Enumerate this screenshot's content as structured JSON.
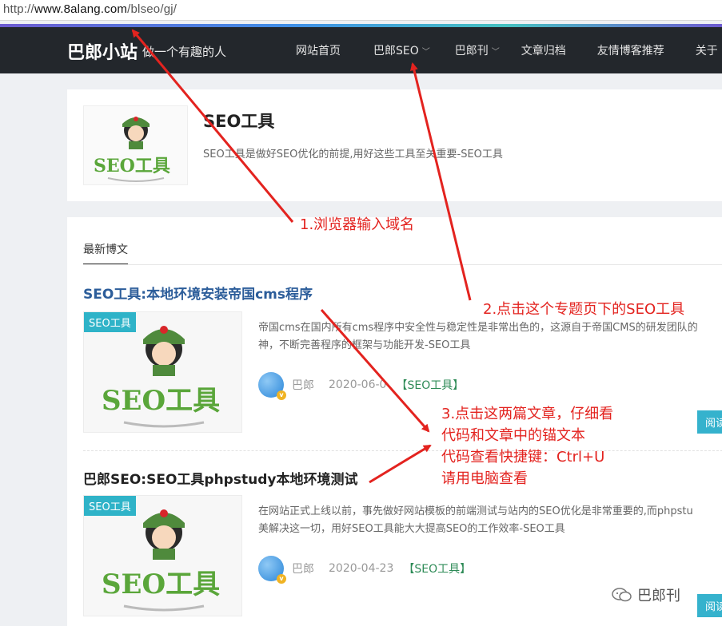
{
  "browser": {
    "url_prefix": "http://",
    "url_domain": "www.8alang.com",
    "url_path": "/blseo/gj/"
  },
  "header": {
    "brand": "巴郎小站",
    "slogan": "做一个有趣的人",
    "nav": [
      {
        "label": "网站首页",
        "dropdown": false
      },
      {
        "label": "巴郎SEO",
        "dropdown": true
      },
      {
        "label": "巴郎刊",
        "dropdown": true
      },
      {
        "label": "文章归档",
        "dropdown": false
      },
      {
        "label": "友情博客推荐",
        "dropdown": false
      },
      {
        "label": "关于",
        "dropdown": false
      }
    ]
  },
  "topic": {
    "title": "SEO工具",
    "description": "SEO工具是做好SEO优化的前提,用好这些工具至关重要-SEO工具",
    "thumb_text": "SEO工具"
  },
  "posts": {
    "tab_label": "最新博文",
    "items": [
      {
        "title": "SEO工具:本地环境安装帝国cms程序",
        "badge": "SEO工具",
        "thumb_text": "SEO工具",
        "excerpt_line1": "帝国cms在国内所有cms程序中安全性与稳定性是非常出色的，这源自于帝国CMS的研发团队的",
        "excerpt_line2": "神，不断完善程序的框架与功能开发-SEO工具",
        "author": "巴郎",
        "date": "2020-06-0",
        "category": "【SEO工具】",
        "read_label": "阅读"
      },
      {
        "title": "巴郎SEO:SEO工具phpstudy本地环境测试",
        "badge": "SEO工具",
        "thumb_text": "SEO工具",
        "excerpt_line1": "在网站正式上线以前，事先做好网站模板的前端测试与站内的SEO优化是非常重要的,而phpstu",
        "excerpt_line2": "美解决这一切，用好SEO工具能大大提高SEO的工作效率-SEO工具",
        "author": "巴郎",
        "date": "2020-04-23",
        "category": "【SEO工具】",
        "read_label": "阅读"
      }
    ]
  },
  "annotations": {
    "step1": "1.浏览器输入域名",
    "step2": "2.点击这个专题页下的SEO工具",
    "step3_line1": "3.点击这两篇文章，仔细看",
    "step3_line2": "代码和文章中的锚文本",
    "step3_line3": "代码查看快捷键：Ctrl+U",
    "step3_line4": "请用电脑查看"
  },
  "watermark": {
    "label": "巴郎刊"
  },
  "colors": {
    "annotation_red": "#e3231f",
    "nav_bg": "#23272c",
    "badge_teal": "#2fb3c8",
    "post_title_blue": "#2c5d9a",
    "category_green": "#2e8b57"
  }
}
